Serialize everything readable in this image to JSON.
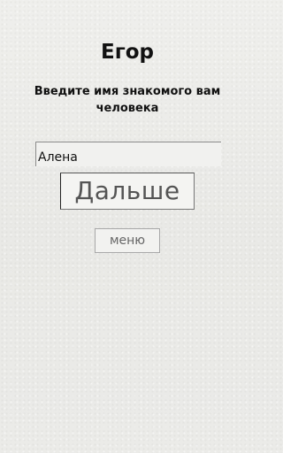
{
  "screen": {
    "title": "Егор",
    "prompt": "Введите имя знакомого вам человека"
  },
  "name_input": {
    "value": "Алена"
  },
  "buttons": {
    "next_label": "Дальше",
    "menu_label": "меню"
  }
}
